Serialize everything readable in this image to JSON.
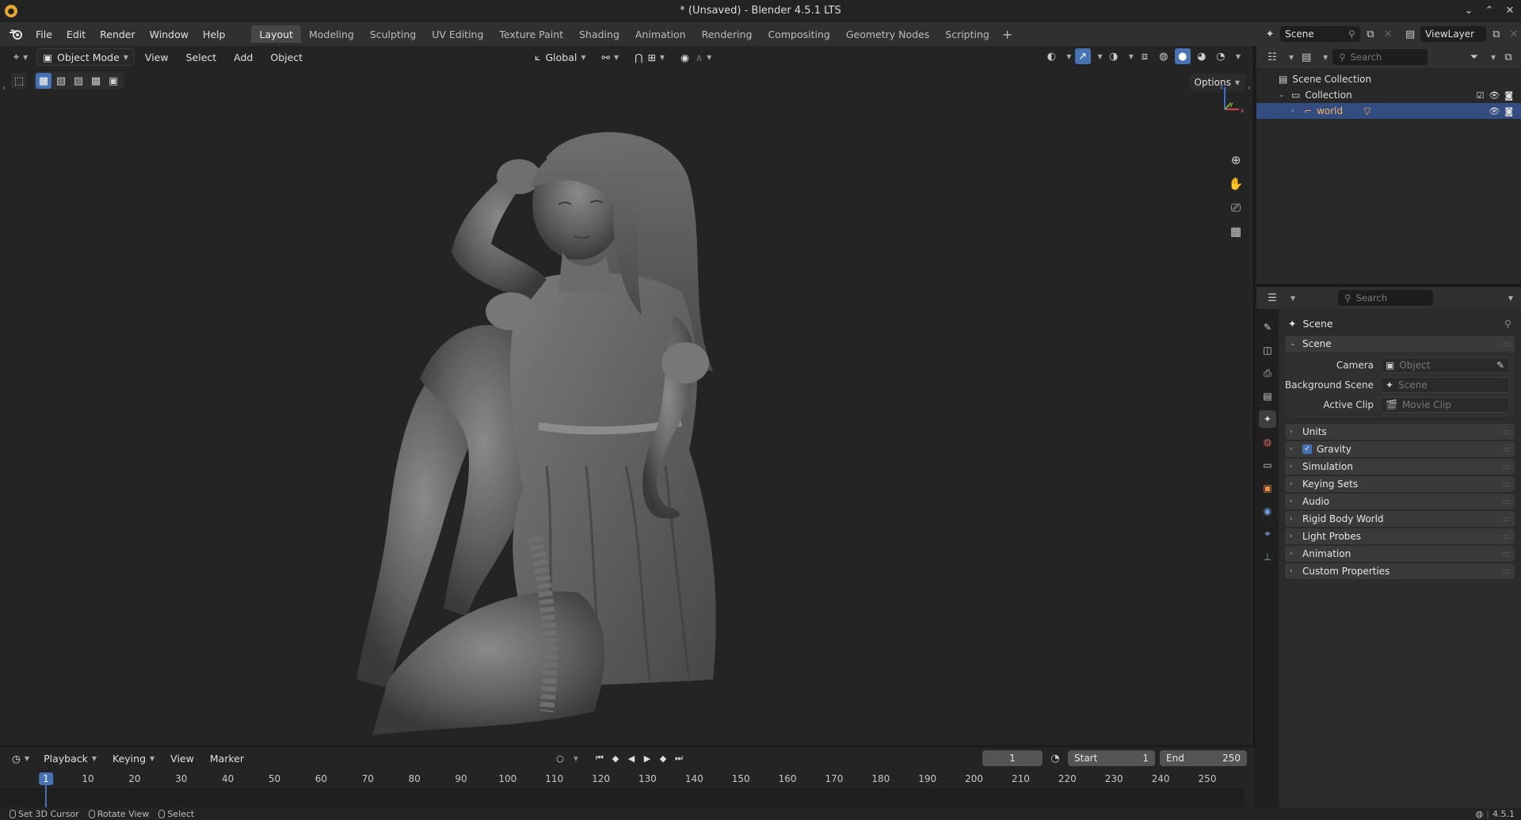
{
  "window": {
    "title": "* (Unsaved) - Blender 4.5.1 LTS",
    "controls": [
      "chevron-down",
      "chevron-up",
      "close"
    ]
  },
  "menu": [
    "File",
    "Edit",
    "Render",
    "Window",
    "Help"
  ],
  "workspaces": [
    "Layout",
    "Modeling",
    "Sculpting",
    "UV Editing",
    "Texture Paint",
    "Shading",
    "Animation",
    "Rendering",
    "Compositing",
    "Geometry Nodes",
    "Scripting"
  ],
  "active_workspace": "Layout",
  "viewport": {
    "mode": "Object Mode",
    "menus": [
      "View",
      "Select",
      "Add",
      "Object"
    ],
    "orientation": "Global",
    "options_label": "Options",
    "gizmo_axes": [
      "z",
      "y",
      "x"
    ]
  },
  "timeline": {
    "menus": [
      "Playback",
      "Keying",
      "View",
      "Marker"
    ],
    "current_frame": "1",
    "start_label": "Start",
    "start_value": "1",
    "end_label": "End",
    "end_value": "250",
    "ruler": [
      "1",
      "10",
      "20",
      "30",
      "40",
      "50",
      "60",
      "70",
      "80",
      "90",
      "100",
      "110",
      "120",
      "130",
      "140",
      "150",
      "160",
      "170",
      "180",
      "190",
      "200",
      "210",
      "220",
      "230",
      "240",
      "250"
    ]
  },
  "statusbar": {
    "hints": [
      "Set 3D Cursor",
      "Rotate View",
      "Select"
    ],
    "version": "4.5.1"
  },
  "scene_selector": {
    "scene": "Scene",
    "view_layer": "ViewLayer"
  },
  "outliner": {
    "search_placeholder": "Search",
    "root": "Scene Collection",
    "collection": "Collection",
    "object": "world"
  },
  "properties": {
    "search_placeholder": "Search",
    "context": "Scene",
    "scene_panel": {
      "title": "Scene",
      "camera_label": "Camera",
      "camera_placeholder": "Object",
      "background_label": "Background Scene",
      "background_placeholder": "Scene",
      "clip_label": "Active Clip",
      "clip_placeholder": "Movie Clip"
    },
    "panels": [
      "Units",
      "Gravity",
      "Simulation",
      "Keying Sets",
      "Audio",
      "Rigid Body World",
      "Light Probes",
      "Animation",
      "Custom Properties"
    ]
  },
  "colors": {
    "accent": "#4772b3",
    "selected_row": "#334d80",
    "viewport_bg": "#242424"
  }
}
